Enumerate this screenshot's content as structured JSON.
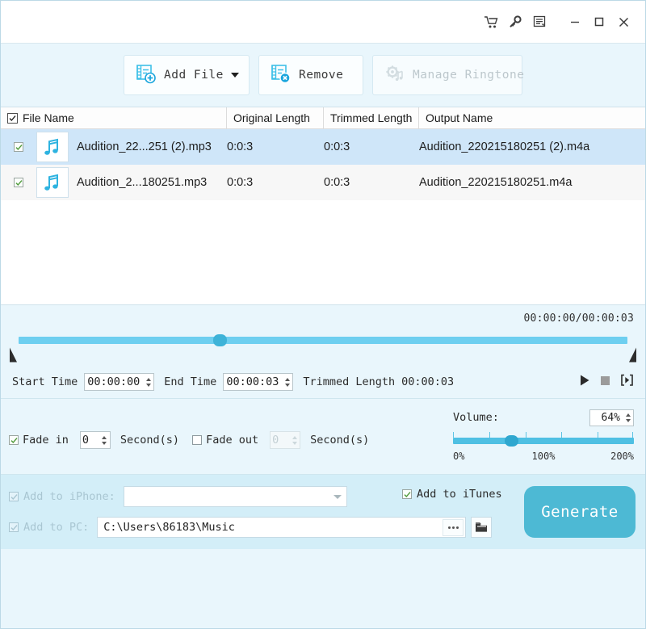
{
  "titlebar": {
    "icons": [
      {
        "name": "cart-icon",
        "label": "Shopping Cart"
      },
      {
        "name": "key-icon",
        "label": "Register Key"
      },
      {
        "name": "menu-icon",
        "label": "Menu"
      },
      {
        "name": "minimize-icon",
        "label": "Minimize"
      },
      {
        "name": "maximize-icon",
        "label": "Maximize"
      },
      {
        "name": "close-icon",
        "label": "Close"
      }
    ]
  },
  "toolbar": {
    "add_file_label": "Add File",
    "remove_label": "Remove",
    "manage_ringtone_label": "Manage Ringtone"
  },
  "filelist": {
    "columns": {
      "file_name": "File Name",
      "original_length": "Original Length",
      "trimmed_length": "Trimmed Length",
      "output_name": "Output Name"
    },
    "select_all_checked": true,
    "rows": [
      {
        "checked": true,
        "file_name": "Audition_22...251 (2).mp3",
        "original_length": "0:0:3",
        "trimmed_length": "0:0:3",
        "output_name": "Audition_220215180251 (2).m4a",
        "selected": true
      },
      {
        "checked": true,
        "file_name": "Audition_2...180251.mp3",
        "original_length": "0:0:3",
        "trimmed_length": "0:0:3",
        "output_name": "Audition_220215180251.m4a",
        "selected": false
      }
    ]
  },
  "player": {
    "time_readout": "00:00:00/00:00:03",
    "start_time_label": "Start Time",
    "start_time_value": "00:00:00",
    "end_time_label": "End Time",
    "end_time_value": "00:00:03",
    "trimmed_length_label": "Trimmed Length",
    "trimmed_length_value": "00:00:03",
    "playhead_percent": 33
  },
  "fade": {
    "fade_in_label": "Fade in",
    "fade_in_checked": true,
    "fade_in_value": "0",
    "fade_in_unit": "Second(s)",
    "fade_out_label": "Fade out",
    "fade_out_checked": false,
    "fade_out_value": "0",
    "fade_out_unit": "Second(s)"
  },
  "volume": {
    "label": "Volume:",
    "value": "64%",
    "scale_min": "0%",
    "scale_mid": "100%",
    "scale_max": "200%",
    "knob_percent": 32
  },
  "bottom": {
    "add_to_iphone_label": "Add to iPhone:",
    "add_to_iphone_checked": true,
    "add_to_iphone_value": "",
    "add_to_pc_label": "Add to PC:",
    "add_to_pc_checked": true,
    "output_path": "C:\\Users\\86183\\Music",
    "add_to_itunes_label": "Add to iTunes",
    "add_to_itunes_checked": true,
    "generate_label": "Generate"
  },
  "colors": {
    "accent": "#4db9d4",
    "panel_bg": "#e9f6fc",
    "bottom_bg": "#d3eef8",
    "selected_row": "#cfe6f9",
    "track": "#6ecff0"
  }
}
